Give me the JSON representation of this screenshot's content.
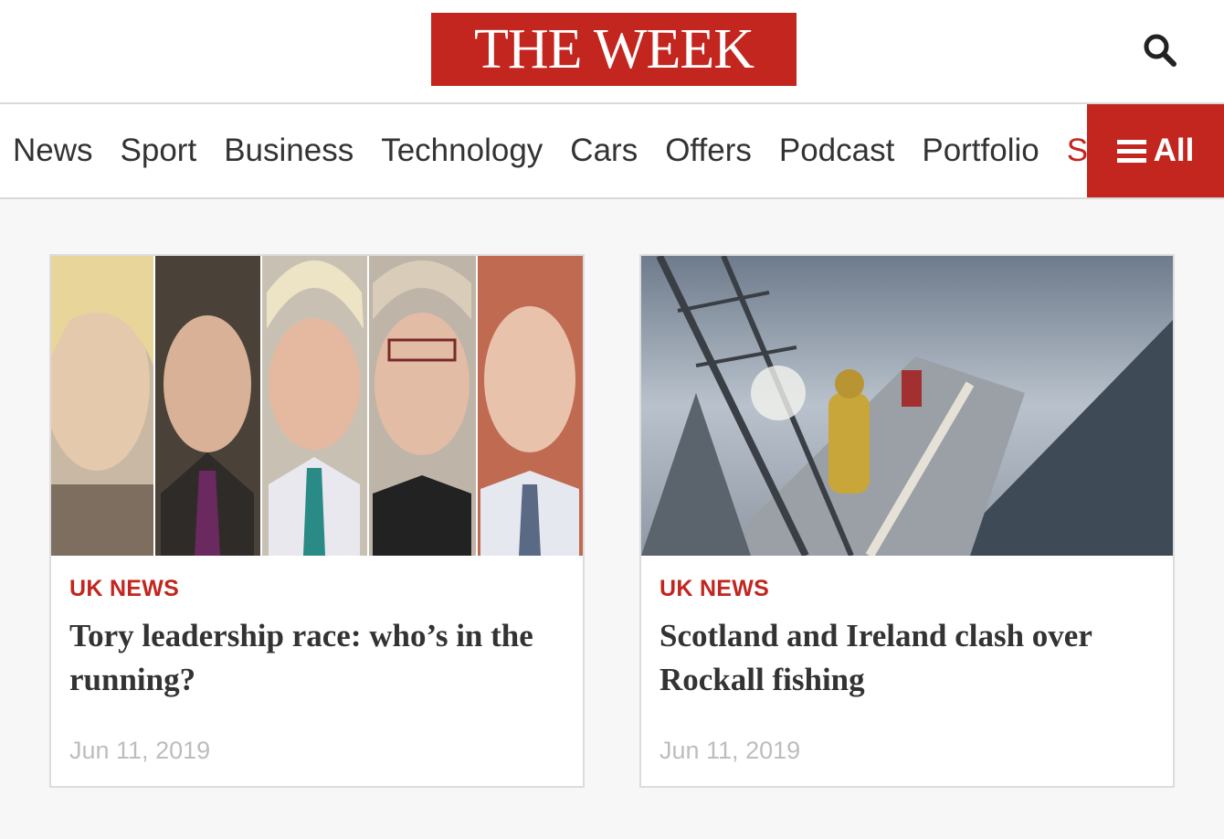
{
  "header": {
    "logo_text": "THE WEEK",
    "search_icon": "search-icon"
  },
  "nav": {
    "items": [
      {
        "label": "News"
      },
      {
        "label": "Sport"
      },
      {
        "label": "Business"
      },
      {
        "label": "Technology"
      },
      {
        "label": "Cars"
      },
      {
        "label": "Offers"
      },
      {
        "label": "Podcast"
      },
      {
        "label": "Portfolio"
      },
      {
        "label": "Su"
      }
    ],
    "all_label": "All",
    "all_icon": "menu-icon"
  },
  "articles": [
    {
      "kicker": "UK NEWS",
      "headline": "Tory leadership race: who’s in the running?",
      "date": "Jun 11, 2019"
    },
    {
      "kicker": "UK NEWS",
      "headline": "Scotland and Ireland clash over Rockall fishing",
      "date": "Jun 11, 2019"
    }
  ],
  "colors": {
    "brand_red": "#c3251f",
    "text_dark": "#333333",
    "date_grey": "#bdbdbd",
    "page_bg": "#f7f7f7"
  }
}
